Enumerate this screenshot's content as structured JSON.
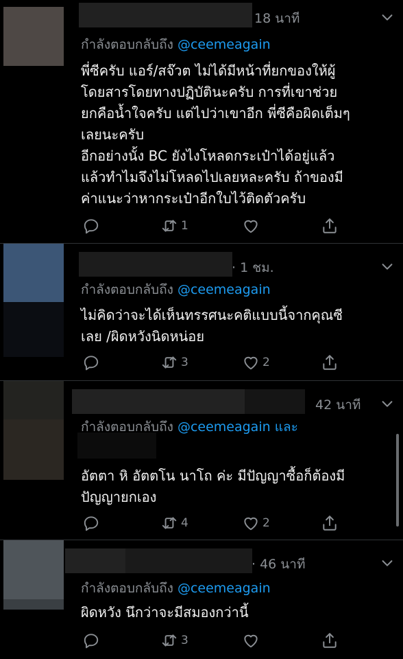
{
  "tweets": [
    {
      "time": "18 นาที",
      "reply_prefix": "กำลังตอบกลับถึง",
      "reply_handle": "@ceemeagain",
      "reply_suffix": "",
      "lines": [
        "พี่ซีครับ แอร์/สจ๊วต ไม่ได้มีหน้าที่ยกของให้ผู้",
        "โดยสารโดยทางปฏิบัตินะครับ การที่เขาช่วย",
        "ยกคือน้ำใจครับ แต่ไปว่าเขาอีก พี่ซีคือผิดเต็มๆ",
        "เลยนะครับ",
        "อีกอย่างนั้ง BC ยังไงโหลดกระเป๋าได้อยู่แล้ว",
        "แล้วทำไมจึงไม่โหลดไปเลยหละครับ ถ้าของมี",
        "ค่าแนะว่าหากระเป๋าอีกใบไว้ติดตัวครับ"
      ],
      "reply_count": "",
      "retweet_count": "1",
      "like_count": ""
    },
    {
      "time": "· 1 ชม.",
      "reply_prefix": "กำลังตอบกลับถึง",
      "reply_handle": "@ceemeagain",
      "reply_suffix": "",
      "lines": [
        "ไม่คิดว่าจะได้เห็นทรรศนะคติแบบนี้จากคุณซี",
        "เลย /ผิดหวังนิดหน่อย"
      ],
      "reply_count": "",
      "retweet_count": "3",
      "like_count": "2"
    },
    {
      "time": "42 นาที",
      "reply_prefix": "กำลังตอบกลับถึง",
      "reply_handle": "@ceemeagain",
      "reply_suffix": "และ",
      "lines": [
        "อัตตา หิ อัตตโน นาโถ ค่ะ มีปัญญาซื้อก็ต้องมี",
        "ปัญญายกเอง"
      ],
      "reply_count": "",
      "retweet_count": "4",
      "like_count": "2"
    },
    {
      "time": "· 46 นาที",
      "reply_prefix": "กำลังตอบกลับถึง",
      "reply_handle": "@ceemeagain",
      "reply_suffix": "",
      "lines": [
        "ผิดหวัง นึกว่าจะมีสมองกว่านี้"
      ],
      "reply_count": "",
      "retweet_count": "3",
      "like_count": ""
    }
  ],
  "icons": {
    "reply": "reply-icon",
    "retweet": "retweet-icon",
    "like": "like-icon",
    "share": "share-icon",
    "menu": "chevron-down-icon"
  },
  "colors": {
    "background": "#000000",
    "text": "#f2f2f2",
    "muted": "#8b8f94",
    "link": "#1d9bf0"
  }
}
